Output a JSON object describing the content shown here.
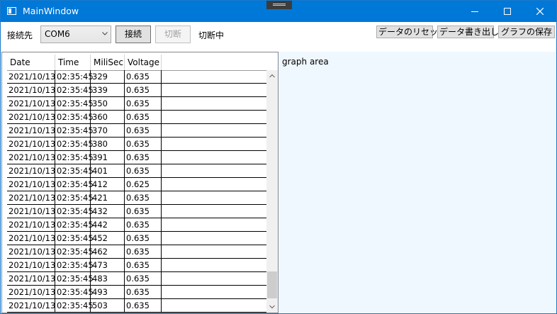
{
  "window": {
    "title": "MainWindow"
  },
  "toolbar": {
    "connect_to_label": "接続先",
    "port_value": "COM6",
    "connect_label": "接続",
    "disconnect_label": "切断",
    "status_text": "切断中",
    "reset_label": "データのリセット",
    "export_label": "データ書き出し",
    "save_graph_label": "グラフの保存"
  },
  "grid": {
    "columns": [
      "Date",
      "Time",
      "MiliSec",
      "Voltage"
    ],
    "rows": [
      [
        "2021/10/13",
        "02:35:45",
        "329",
        "0.635"
      ],
      [
        "2021/10/13",
        "02:35:45",
        "339",
        "0.635"
      ],
      [
        "2021/10/13",
        "02:35:45",
        "350",
        "0.635"
      ],
      [
        "2021/10/13",
        "02:35:45",
        "360",
        "0.635"
      ],
      [
        "2021/10/13",
        "02:35:45",
        "370",
        "0.635"
      ],
      [
        "2021/10/13",
        "02:35:45",
        "380",
        "0.635"
      ],
      [
        "2021/10/13",
        "02:35:45",
        "391",
        "0.635"
      ],
      [
        "2021/10/13",
        "02:35:45",
        "401",
        "0.635"
      ],
      [
        "2021/10/13",
        "02:35:45",
        "412",
        "0.625"
      ],
      [
        "2021/10/13",
        "02:35:45",
        "421",
        "0.635"
      ],
      [
        "2021/10/13",
        "02:35:45",
        "432",
        "0.635"
      ],
      [
        "2021/10/13",
        "02:35:45",
        "442",
        "0.635"
      ],
      [
        "2021/10/13",
        "02:35:45",
        "452",
        "0.635"
      ],
      [
        "2021/10/13",
        "02:35:45",
        "462",
        "0.635"
      ],
      [
        "2021/10/13",
        "02:35:45",
        "473",
        "0.635"
      ],
      [
        "2021/10/13",
        "02:35:45",
        "483",
        "0.635"
      ],
      [
        "2021/10/13",
        "02:35:45",
        "493",
        "0.635"
      ],
      [
        "2021/10/13",
        "02:35:45",
        "503",
        "0.635"
      ]
    ]
  },
  "graph": {
    "label": "graph area"
  },
  "colors": {
    "titlebar": "#0078d7",
    "graph_bg": "#f0f8ff"
  }
}
